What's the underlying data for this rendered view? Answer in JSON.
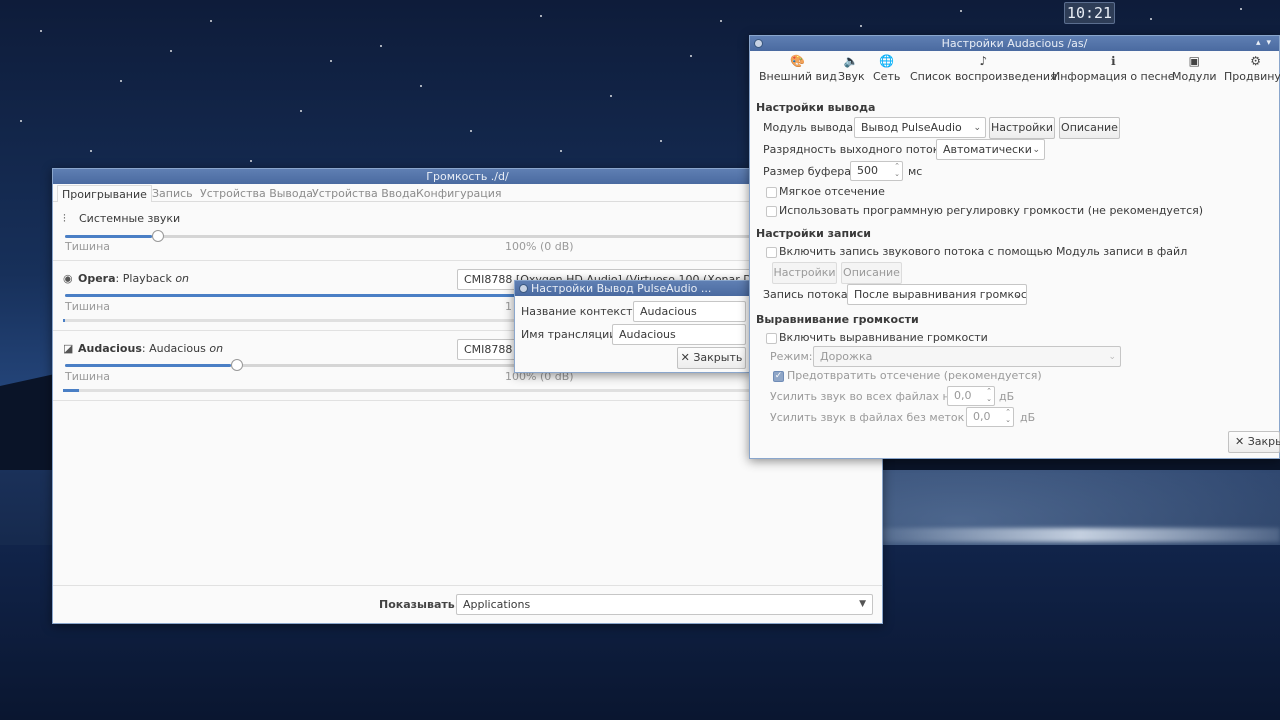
{
  "clock": "10:21",
  "volume": {
    "title": "Громкость  ./d/",
    "tabs": [
      "Проигрывание",
      "Запись",
      "Устройства Вывода",
      "Устройства Ввода",
      "Конфигурация"
    ],
    "system": {
      "name": "Системные звуки",
      "left_label": "Тишина",
      "level_label": "100% (0 dB)"
    },
    "opera": {
      "app": "Opera",
      "desc": ": Playback ",
      "state": "on",
      "device": "CMI8788 [Oxygen HD Audio] (Virtuoso 100 (Xonar D1)) A",
      "left_label": "Тишина",
      "level_label": "1"
    },
    "audacious": {
      "app": "Audacious",
      "desc": ": Audacious ",
      "state": "on",
      "device": "CMI8788 [",
      "left_label": "Тишина",
      "level_label": "100% (0 dB)"
    },
    "show_label": "Показывать:",
    "show_value": "Applications"
  },
  "pulse_dialog": {
    "title": "Настройки Вывод PulseAudio ...",
    "context_label": "Название контекста:",
    "context_value": "Audacious",
    "stream_label": "Имя трансляции:",
    "stream_value": "Audacious",
    "close_label": "✕ Закрыть"
  },
  "audacious_settings": {
    "title": "Настройки Audacious  /as/",
    "toolbar": [
      {
        "icon": "palette-icon",
        "glyph": "🎨",
        "label": "Внешний вид"
      },
      {
        "icon": "speaker-icon",
        "glyph": "🔈",
        "label": "Звук"
      },
      {
        "icon": "globe-icon",
        "glyph": "🌐",
        "label": "Сеть"
      },
      {
        "icon": "music-note-icon",
        "glyph": "♪",
        "label": "Список воспроизведения"
      },
      {
        "icon": "info-icon",
        "glyph": "ℹ",
        "label": "Информация о песне"
      },
      {
        "icon": "plugin-icon",
        "glyph": "▣",
        "label": "Модули"
      },
      {
        "icon": "gear-icon",
        "glyph": "⚙",
        "label": "Продвинут"
      }
    ],
    "output_section": "Настройки вывода",
    "output_module_label": "Модуль вывода:",
    "output_module_value": "Вывод PulseAudio",
    "settings_button": "Настройки",
    "description_button": "Описание",
    "bit_depth_label": "Разрядность выходного потока:",
    "bit_depth_value": "Автоматически",
    "buffer_label": "Размер буфера:",
    "buffer_value": "500",
    "buffer_unit": "мс",
    "soft_clip_label": "Мягкое отсечение",
    "software_volume_label": "Использовать программную регулировку громкости (не рекомендуется)",
    "record_section": "Настройки записи",
    "record_enable_label": "Включить запись звукового потока с помощью Модуль записи в файл",
    "record_settings_button": "Настройки",
    "record_description_button": "Описание",
    "record_stream_label": "Запись потока:",
    "record_stream_value": "После выравнивания громкости",
    "replaygain_section": "Выравнивание громкости",
    "replaygain_enable_label": "Включить выравнивание громкости",
    "mode_label": "Режим:",
    "mode_value": "Дорожка",
    "prevent_clip_label": "Предотвратить отсечение (рекомендуется)",
    "amplify_all_label": "Усилить звук во всех файлах на:",
    "amplify_all_value": "0,0",
    "amplify_all_unit": "дБ",
    "amplify_untagged_label": "Усилить звук в файлах без меток на:",
    "amplify_untagged_value": "0,0",
    "amplify_untagged_unit": "дБ",
    "close_label": "✕ Закры"
  }
}
